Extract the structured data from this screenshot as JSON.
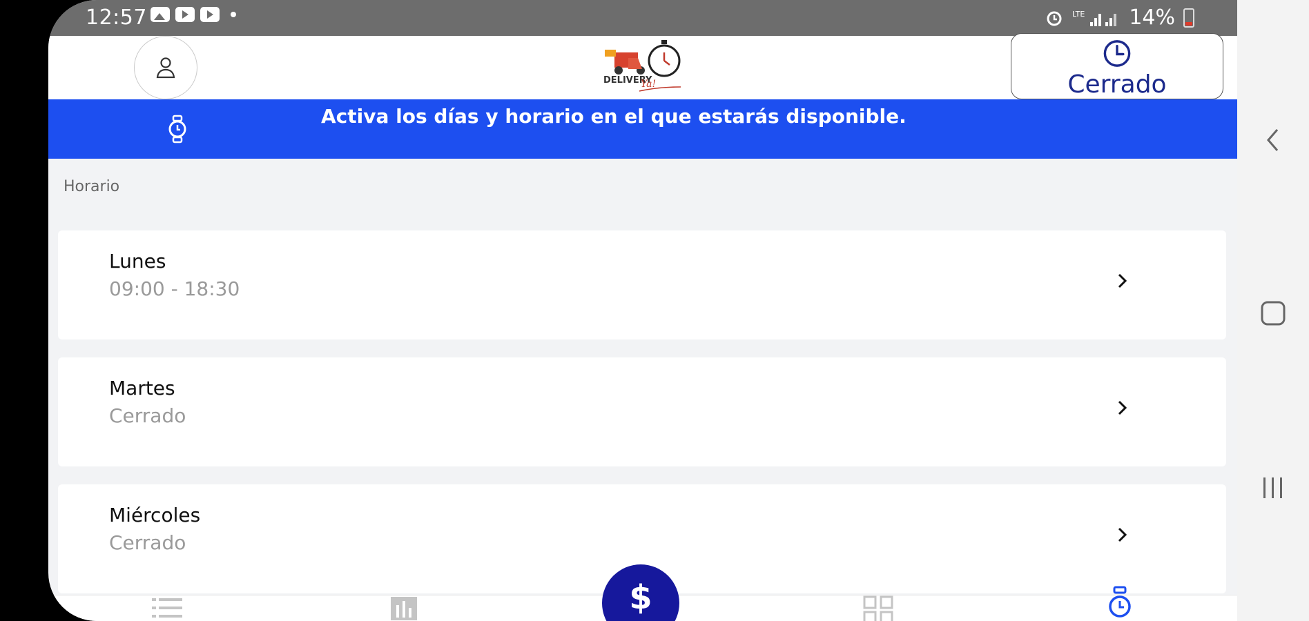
{
  "status_bar": {
    "time": "12:57",
    "battery": "14%"
  },
  "header": {
    "open_status": "Cerrado"
  },
  "banner": {
    "message": "Activa los días y horario en el que estarás disponible."
  },
  "section_label": "Horario",
  "days": [
    {
      "name": "Lunes",
      "hours": "09:00 - 18:30"
    },
    {
      "name": "Martes",
      "hours": "Cerrado"
    },
    {
      "name": "Miércoles",
      "hours": "Cerrado"
    }
  ],
  "fab": {
    "symbol": "$"
  },
  "colors": {
    "banner": "#1d4ff0",
    "fab": "#16189c",
    "status_text": "#1c2a8c"
  }
}
